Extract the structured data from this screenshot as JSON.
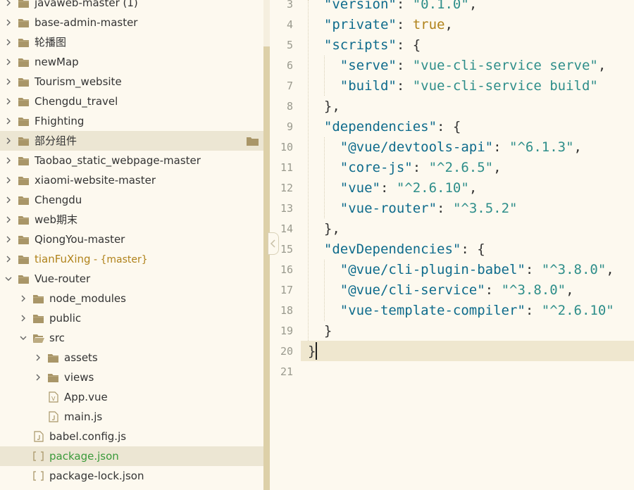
{
  "sidebar": {
    "items": [
      {
        "label": "javaweb-master (1)",
        "depth": 0,
        "type": "folder",
        "chevron": "right"
      },
      {
        "label": "base-admin-master",
        "depth": 0,
        "type": "folder",
        "chevron": "right"
      },
      {
        "label": "轮播图",
        "depth": 0,
        "type": "folder",
        "chevron": "right"
      },
      {
        "label": "newMap",
        "depth": 0,
        "type": "folder",
        "chevron": "right"
      },
      {
        "label": "Tourism_website",
        "depth": 0,
        "type": "folder",
        "chevron": "right"
      },
      {
        "label": "Chengdu_travel",
        "depth": 0,
        "type": "folder",
        "chevron": "right"
      },
      {
        "label": "Fhighting",
        "depth": 0,
        "type": "folder",
        "chevron": "right"
      },
      {
        "label": "部分组件",
        "depth": 0,
        "type": "folder",
        "chevron": "right",
        "state": "hover"
      },
      {
        "label": "Taobao_static_webpage-master",
        "depth": 0,
        "type": "folder",
        "chevron": "right"
      },
      {
        "label": "xiaomi-website-master",
        "depth": 0,
        "type": "folder",
        "chevron": "right"
      },
      {
        "label": "Chengdu",
        "depth": 0,
        "type": "folder",
        "chevron": "right"
      },
      {
        "label": "web期末",
        "depth": 0,
        "type": "folder",
        "chevron": "right"
      },
      {
        "label": "QiongYou-master",
        "depth": 0,
        "type": "folder",
        "chevron": "right"
      },
      {
        "label": "tianFuXing",
        "git": " - {master}",
        "depth": 0,
        "type": "folder",
        "chevron": "right",
        "color": "#b0821a"
      },
      {
        "label": "Vue-router",
        "depth": 0,
        "type": "folder",
        "chevron": "down"
      },
      {
        "label": "node_modules",
        "depth": 1,
        "type": "folder",
        "chevron": "right"
      },
      {
        "label": "public",
        "depth": 1,
        "type": "folder",
        "chevron": "right"
      },
      {
        "label": "src",
        "depth": 1,
        "type": "folder-open",
        "chevron": "down"
      },
      {
        "label": "assets",
        "depth": 2,
        "type": "folder",
        "chevron": "right"
      },
      {
        "label": "views",
        "depth": 2,
        "type": "folder",
        "chevron": "right"
      },
      {
        "label": "App.vue",
        "depth": 2,
        "type": "vue-file"
      },
      {
        "label": "main.js",
        "depth": 2,
        "type": "js-file"
      },
      {
        "label": "babel.config.js",
        "depth": 1,
        "type": "js-file"
      },
      {
        "label": "package.json",
        "depth": 1,
        "type": "json-file",
        "state": "selected",
        "color": "#3a9a3a"
      },
      {
        "label": "package-lock.json",
        "depth": 1,
        "type": "json-file"
      }
    ]
  },
  "editor": {
    "line_numbers": [
      "3",
      "4",
      "5",
      "6",
      "7",
      "8",
      "9",
      "10",
      "11",
      "12",
      "13",
      "14",
      "15",
      "16",
      "17",
      "18",
      "19",
      "20",
      "21"
    ],
    "current_line": "20",
    "colors": {
      "key": "#0e6b8c",
      "string": "#2e8e8a",
      "boolean": "#b0821a",
      "plain": "#333333"
    },
    "lines": [
      [
        {
          "t": "  "
        },
        {
          "t": "\"version\"",
          "c": "k"
        },
        {
          "t": ": "
        },
        {
          "t": "\"0.1.0\"",
          "c": "s"
        },
        {
          "t": ","
        }
      ],
      [
        {
          "t": "  "
        },
        {
          "t": "\"private\"",
          "c": "k"
        },
        {
          "t": ": "
        },
        {
          "t": "true",
          "c": "b"
        },
        {
          "t": ","
        }
      ],
      [
        {
          "t": "  "
        },
        {
          "t": "\"scripts\"",
          "c": "k"
        },
        {
          "t": ": {"
        }
      ],
      [
        {
          "t": "    "
        },
        {
          "t": "\"serve\"",
          "c": "k"
        },
        {
          "t": ": "
        },
        {
          "t": "\"vue-cli-service serve\"",
          "c": "s"
        },
        {
          "t": ","
        }
      ],
      [
        {
          "t": "    "
        },
        {
          "t": "\"build\"",
          "c": "k"
        },
        {
          "t": ": "
        },
        {
          "t": "\"vue-cli-service build\"",
          "c": "s"
        }
      ],
      [
        {
          "t": "  },"
        }
      ],
      [
        {
          "t": "  "
        },
        {
          "t": "\"dependencies\"",
          "c": "k"
        },
        {
          "t": ": {"
        }
      ],
      [
        {
          "t": "    "
        },
        {
          "t": "\"@vue/devtools-api\"",
          "c": "k"
        },
        {
          "t": ": "
        },
        {
          "t": "\"^6.1.3\"",
          "c": "s"
        },
        {
          "t": ","
        }
      ],
      [
        {
          "t": "    "
        },
        {
          "t": "\"core-js\"",
          "c": "k"
        },
        {
          "t": ": "
        },
        {
          "t": "\"^2.6.5\"",
          "c": "s"
        },
        {
          "t": ","
        }
      ],
      [
        {
          "t": "    "
        },
        {
          "t": "\"vue\"",
          "c": "k"
        },
        {
          "t": ": "
        },
        {
          "t": "\"^2.6.10\"",
          "c": "s"
        },
        {
          "t": ","
        }
      ],
      [
        {
          "t": "    "
        },
        {
          "t": "\"vue-router\"",
          "c": "k"
        },
        {
          "t": ": "
        },
        {
          "t": "\"^3.5.2\"",
          "c": "s"
        }
      ],
      [
        {
          "t": "  },"
        }
      ],
      [
        {
          "t": "  "
        },
        {
          "t": "\"devDependencies\"",
          "c": "k"
        },
        {
          "t": ": {"
        }
      ],
      [
        {
          "t": "    "
        },
        {
          "t": "\"@vue/cli-plugin-babel\"",
          "c": "k"
        },
        {
          "t": ": "
        },
        {
          "t": "\"^3.8.0\"",
          "c": "s"
        },
        {
          "t": ","
        }
      ],
      [
        {
          "t": "    "
        },
        {
          "t": "\"@vue/cli-service\"",
          "c": "k"
        },
        {
          "t": ": "
        },
        {
          "t": "\"^3.8.0\"",
          "c": "s"
        },
        {
          "t": ","
        }
      ],
      [
        {
          "t": "    "
        },
        {
          "t": "\"vue-template-compiler\"",
          "c": "k"
        },
        {
          "t": ": "
        },
        {
          "t": "\"^2.6.10\"",
          "c": "s"
        }
      ],
      [
        {
          "t": "  }"
        }
      ],
      [
        {
          "t": "}"
        }
      ],
      []
    ]
  }
}
